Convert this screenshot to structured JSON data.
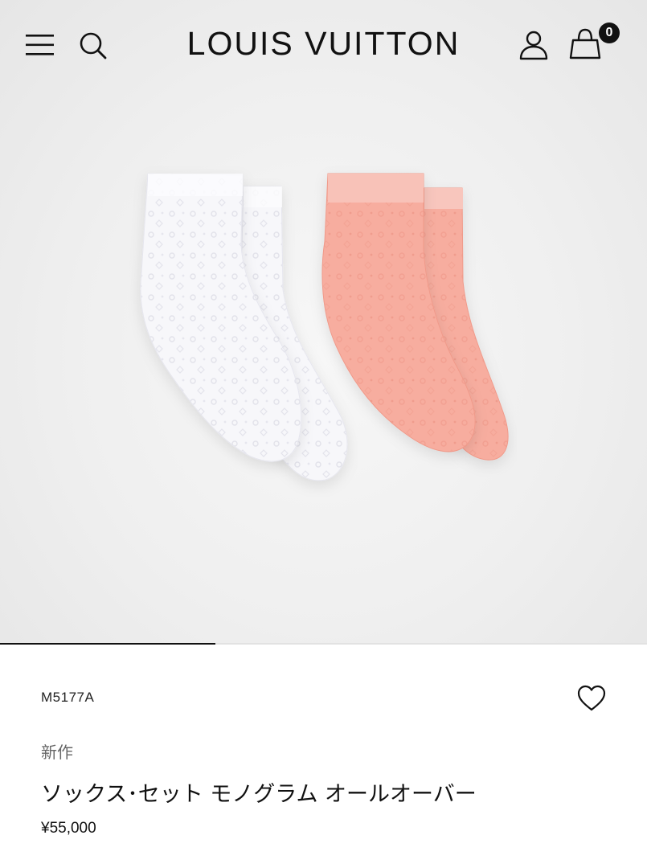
{
  "header": {
    "brand": "LOUIS VUITTON",
    "icons": [
      "menu-icon",
      "search-icon",
      "account-icon",
      "shopping-bag-icon"
    ],
    "bag_count": "0"
  },
  "product": {
    "sku": "M5177A",
    "badge": "新作",
    "name": "ソックス･セット モノグラム オールオーバー",
    "price": "¥55,000",
    "image_icon": "wishlist-heart-icon"
  },
  "carousel": {
    "progress": 0.333
  },
  "colors": {
    "white_sock": "#f6f6f9",
    "pink_sock": "#f6b0a4",
    "pink_cuff": "#f7c0b6",
    "text": "#111111",
    "muted": "#666666"
  }
}
